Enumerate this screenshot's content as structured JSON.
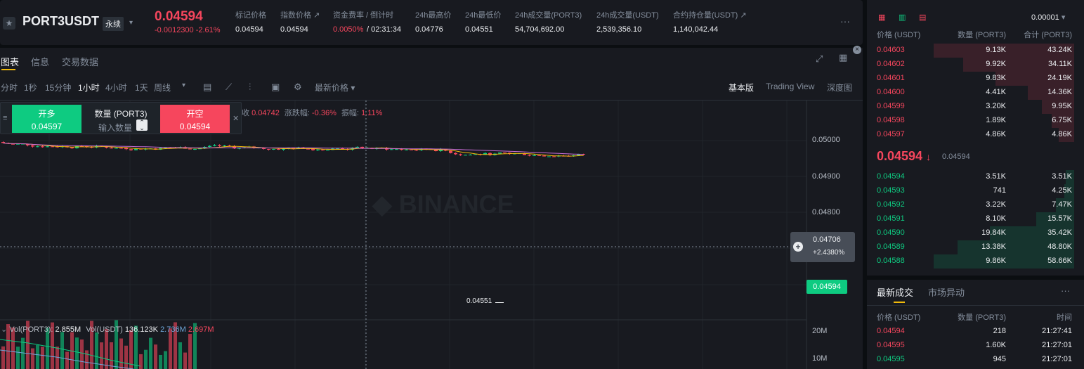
{
  "header": {
    "symbol": "PORT3USDT",
    "badge": "永续",
    "last_price": "0.04594",
    "change": "-0.0012300 -2.61%",
    "stats": [
      {
        "label": "标记价格",
        "value": "0.04594"
      },
      {
        "label": "指数价格 ↗",
        "value": "0.04594"
      },
      {
        "label": "资金费率 / 倒计时",
        "value_rate": "0.0050%",
        "value_count": "/ 02:31:34"
      },
      {
        "label": "24h最高价",
        "value": "0.04776"
      },
      {
        "label": "24h最低价",
        "value": "0.04551"
      },
      {
        "label": "24h成交量(PORT3)",
        "value": "54,704,692.00"
      },
      {
        "label": "24h成交量(USDT)",
        "value": "2,539,356.10"
      },
      {
        "label": "合约持仓量(USDT) ↗",
        "value": "1,140,042.44"
      }
    ]
  },
  "chart_tabs": [
    "图表",
    "信息",
    "交易数据"
  ],
  "timeframes": [
    "分时",
    "1秒",
    "15分钟",
    "1小时",
    "4小时",
    "1天",
    "周线"
  ],
  "price_type": "最新价格",
  "versions": [
    "基本版",
    "Trading View",
    "深度图"
  ],
  "order_widget": {
    "long_label": "开多",
    "long_price": "0.04597",
    "qty_label": "数量 (PORT3)",
    "qty_placeholder": "输入数量",
    "short_label": "开空",
    "short_price": "0.04594"
  },
  "ohlc_info": {
    "close_label": "收",
    "close": "0.04742",
    "chg_label": "涨跌幅:",
    "chg": "-0.36%",
    "amp_label": "振幅:",
    "amp": "1.11%"
  },
  "price_axis": [
    "0.05000",
    "0.04900",
    "0.04800"
  ],
  "crosshair": {
    "price": "0.04706",
    "pct": "+2.4380%"
  },
  "current_price_tag": "0.04594",
  "low_label": "0.04551",
  "vol_legend": {
    "vol_port3_label": "Vol(PORT3):",
    "vol_port3": "2.855M",
    "vol_usdt_label": "Vol(USDT)",
    "vol_usdt": "136.123K",
    "v1": "2.736M",
    "v2": "2.697M"
  },
  "vol_axis": [
    "20M",
    "10M"
  ],
  "orderbook": {
    "tick": "0.00001",
    "headers": [
      "价格 (USDT)",
      "数量 (PORT3)",
      "合计 (PORT3)"
    ],
    "asks": [
      [
        "0.04603",
        "9.13K",
        "43.24K",
        1.0
      ],
      [
        "0.04602",
        "9.92K",
        "34.11K",
        0.79
      ],
      [
        "0.04601",
        "9.83K",
        "24.19K",
        0.56
      ],
      [
        "0.04600",
        "4.41K",
        "14.36K",
        0.33
      ],
      [
        "0.04599",
        "3.20K",
        "9.95K",
        0.23
      ],
      [
        "0.04598",
        "1.89K",
        "6.75K",
        0.16
      ],
      [
        "0.04597",
        "4.86K",
        "4.86K",
        0.11
      ]
    ],
    "mid_price": "0.04594",
    "mid_mark": "0.04594",
    "bids": [
      [
        "0.04594",
        "3.51K",
        "3.51K",
        0.06
      ],
      [
        "0.04593",
        "741",
        "4.25K",
        0.07
      ],
      [
        "0.04592",
        "3.22K",
        "7.47K",
        0.13
      ],
      [
        "0.04591",
        "8.10K",
        "15.57K",
        0.27
      ],
      [
        "0.04590",
        "19.84K",
        "35.42K",
        0.6
      ],
      [
        "0.04589",
        "13.38K",
        "48.80K",
        0.83
      ],
      [
        "0.04588",
        "9.86K",
        "58.66K",
        1.0
      ]
    ]
  },
  "trades": {
    "tabs": [
      "最新成交",
      "市场异动"
    ],
    "headers": [
      "价格 (USDT)",
      "数量 (PORT3)",
      "时间"
    ],
    "rows": [
      [
        "0.04594",
        "218",
        "21:27:41",
        "down"
      ],
      [
        "0.04595",
        "1.60K",
        "21:27:01",
        "down"
      ],
      [
        "0.04595",
        "945",
        "21:27:01",
        "up"
      ]
    ]
  },
  "colors": {
    "up": "#0ecb81",
    "down": "#f6465d",
    "accent": "#f0b90b"
  }
}
